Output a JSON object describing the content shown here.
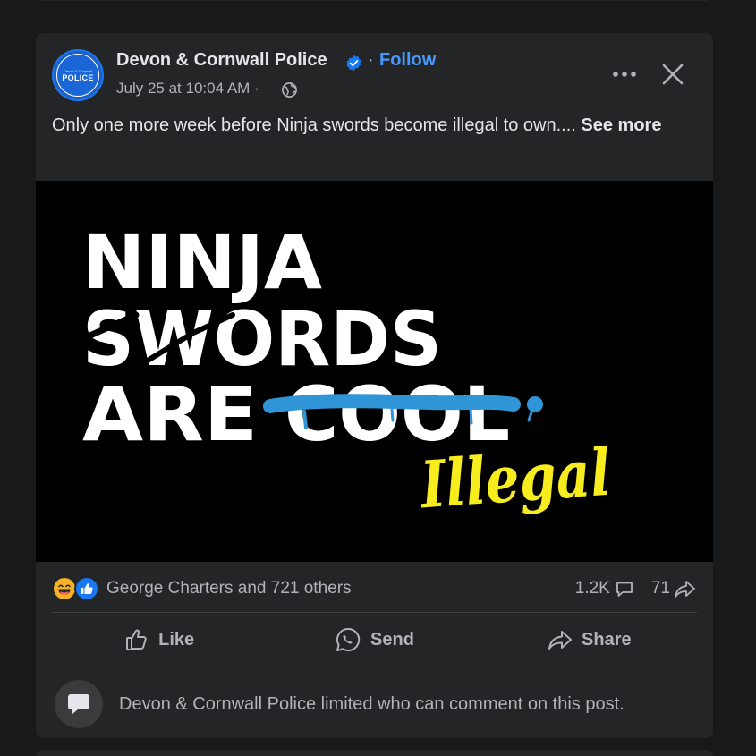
{
  "post": {
    "page_name": "Devon & Cornwall Police",
    "avatar_small_text": "Devon & Cornwall",
    "avatar_text": "POLICE",
    "separator": "·",
    "follow_label": "Follow",
    "timestamp": "July 25 at 10:04 AM ·",
    "text": "Only one more week before Ninja swords become illegal to own....",
    "see_more_label": "See more"
  },
  "image": {
    "line1": "NINJA",
    "line2": "SWORDS",
    "line3_word1": "ARE",
    "line3_word2": "COOL",
    "handwritten": "Illegal",
    "colors": {
      "background": "#000000",
      "text": "#ffffff",
      "paint": "#2f95d6",
      "highlight": "#f6ec1e"
    }
  },
  "reactions": {
    "types": [
      "haha-icon",
      "like-icon"
    ],
    "summary": "George Charters and 721 others",
    "comments": "1.2K",
    "shares": "71"
  },
  "actions": {
    "like": "Like",
    "send": "Send",
    "share": "Share"
  },
  "comments": {
    "restricted_notice": "Devon & Cornwall Police limited who can comment on this post."
  },
  "colors": {
    "card_bg": "#242526",
    "page_bg": "#18191a",
    "accent": "#4599ff",
    "primary_text": "#e4e6eb",
    "secondary_text": "#b0b3b8"
  }
}
